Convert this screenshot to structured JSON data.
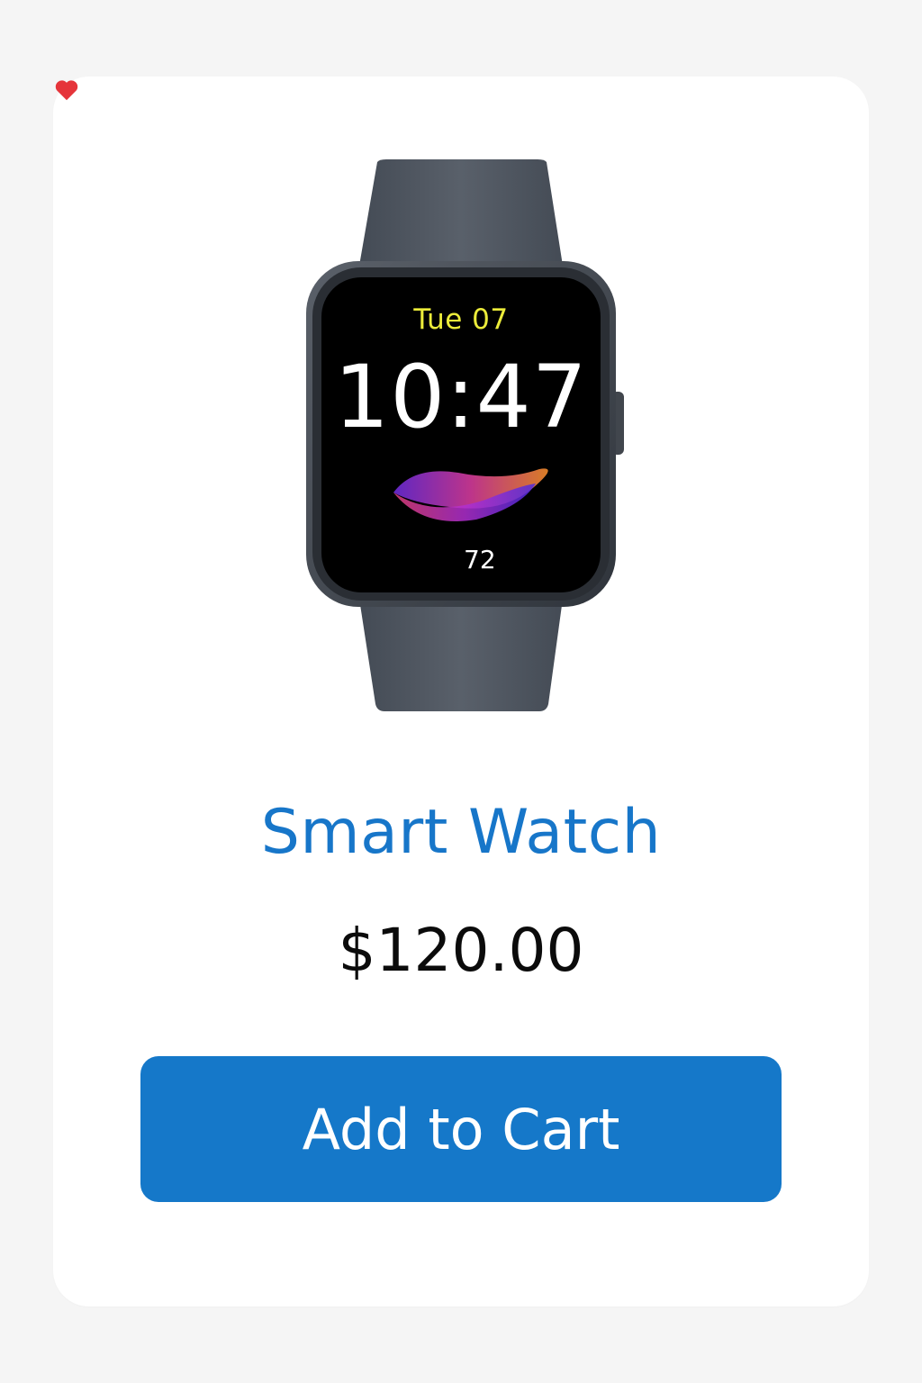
{
  "product": {
    "title": "Smart Watch",
    "price": "$120.00",
    "image_icon": "smart-watch-image"
  },
  "watch_face": {
    "date": "Tue 07",
    "time": "10:47",
    "heart_rate": "72",
    "heart_icon": "heart-icon"
  },
  "cart": {
    "add_label": "Add to Cart"
  },
  "colors": {
    "accent": "#1578C9",
    "title": "#1776C9",
    "background": "#F5F5F5",
    "card": "#FFFFFF",
    "watch_date": "#ECEC3A"
  }
}
